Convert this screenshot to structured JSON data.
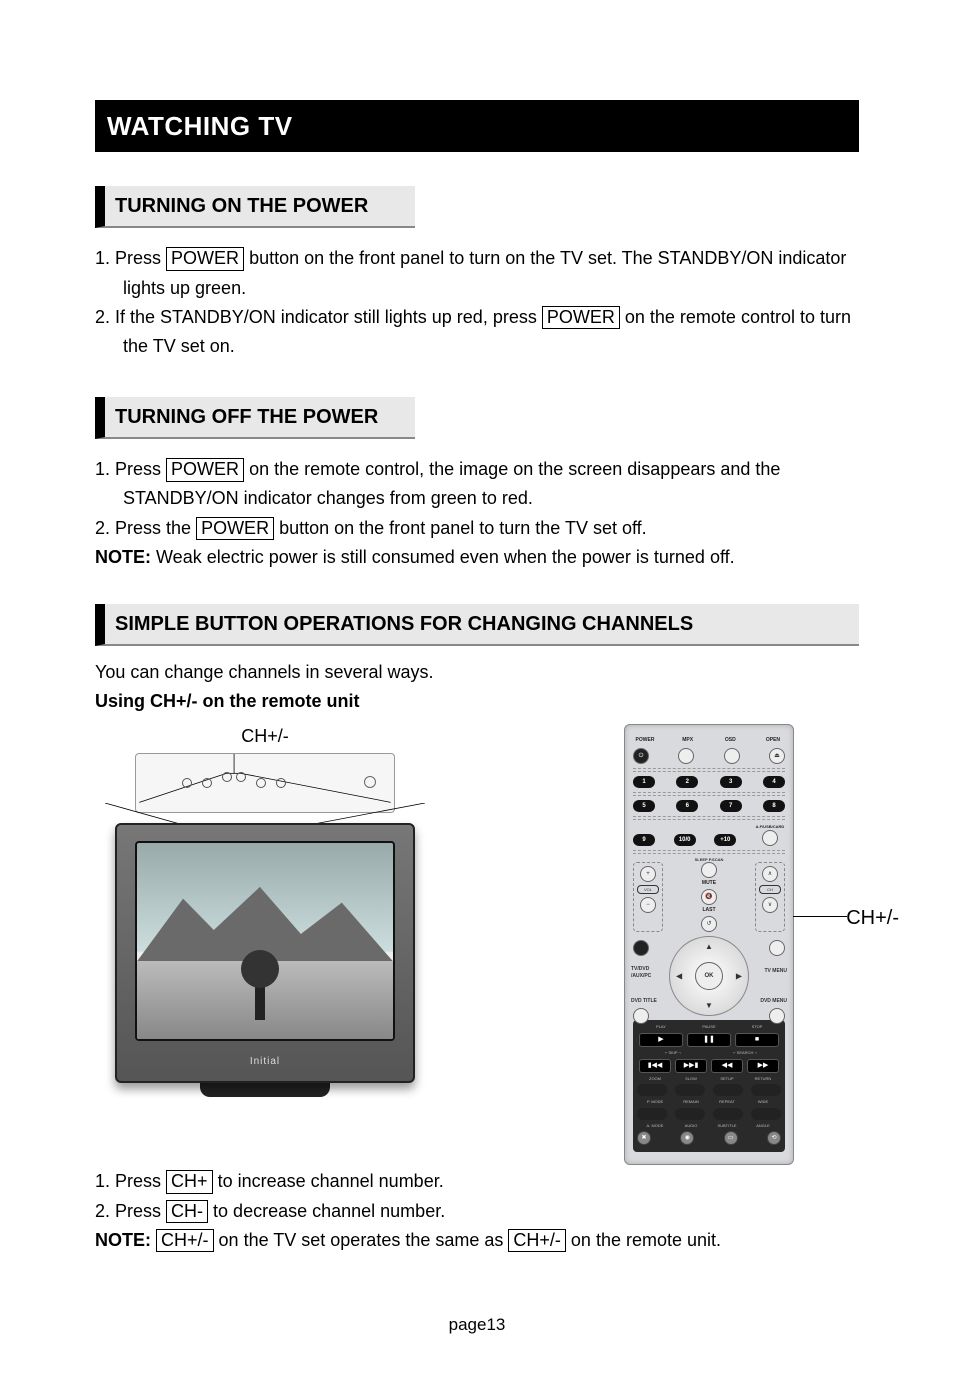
{
  "chapter_title": "WATCHING TV",
  "section1": {
    "title": "TURNING ON THE POWER",
    "step1_a": "1. Press ",
    "step1_btn": "POWER",
    "step1_b": " button on the front panel to turn on the TV set. The STANDBY/ON indicator",
    "step1_c": "lights up green.",
    "step2_a": "2. If the STANDBY/ON indicator still lights up red, press ",
    "step2_btn": "POWER",
    "step2_b": " on the remote control to turn",
    "step2_c": "the TV set on."
  },
  "section2": {
    "title": "TURNING OFF THE POWER",
    "step1_a": "1. Press ",
    "step1_btn": "POWER",
    "step1_b": " on the remote control, the image on the screen disappears and the",
    "step1_c": "STANDBY/ON indicator changes from green to red.",
    "step2_a": "2. Press the ",
    "step2_btn": "POWER",
    "step2_b": " button on the front panel to turn the TV set off.",
    "note_label": "NOTE:",
    "note_text": " Weak electric power is still consumed even when the power is turned off."
  },
  "section3": {
    "title": "SIMPLE BUTTON OPERATIONS FOR CHANGING CHANNELS",
    "intro": "You can change channels in several ways.",
    "subhead": "Using CH+/- on the remote unit",
    "tv_label": "CH+/-",
    "remote_label": "CH+/-",
    "step1_a": "1. Press ",
    "step1_btn": "CH+ ",
    "step1_b": "to increase channel number.",
    "step2_a": "2. Press ",
    "step2_btn": "CH- ",
    "step2_b": " to decrease channel number.",
    "note_label": "NOTE:",
    "note_btn1": "CH+/- ",
    "note_mid": "on the TV set operates the same as ",
    "note_btn2": "CH+/- ",
    "note_end": "on the remote unit."
  },
  "remote": {
    "top_labels": [
      "POWER",
      "MPX",
      "OSD",
      "OPEN"
    ],
    "top_icons": [
      "⏻",
      "",
      "",
      "⏏"
    ],
    "num_row1": [
      "1",
      "2",
      "3",
      "4"
    ],
    "num_row2": [
      "5",
      "6",
      "7",
      "8"
    ],
    "num_row3": [
      "9",
      "10/0",
      "+10",
      ""
    ],
    "row3_side": "A.F/USB/CARD",
    "sleep_p_scan": "SLEEP  P.SCAN",
    "vol_label": "VOL",
    "ch_label": "CH",
    "mute": "MUTE",
    "last": "LAST",
    "source_lbl": "TV/DVD\n/AUX/PC",
    "tvmenu": "TV MENU",
    "dvdtitle": "DVD TITLE",
    "dvdmenu": "DVD MENU",
    "ok": "OK",
    "transport_top": [
      "PLAY",
      "PAUSE",
      "STOP"
    ],
    "transport_icons_top": [
      "▶",
      "❚❚",
      "■"
    ],
    "skip_label": "SKIP",
    "search_label": "SEARCH",
    "transport_icons_mid": [
      "▮◀◀",
      "▶▶▮",
      "◀◀",
      "▶▶"
    ],
    "row_labels_a": [
      "ZOOM",
      "SLOW",
      "SETUP",
      "RETURN"
    ],
    "row_labels_b": [
      "P. MODE",
      "REMAIN",
      "REPEAT",
      "WIDE"
    ],
    "row_labels_c": [
      "A. MODE",
      "AUDIO",
      "SUBTITLE",
      "ANGLE"
    ],
    "bottom_icons": [
      "✖",
      "◉",
      "▭",
      "⟲"
    ]
  },
  "footer": "page13"
}
